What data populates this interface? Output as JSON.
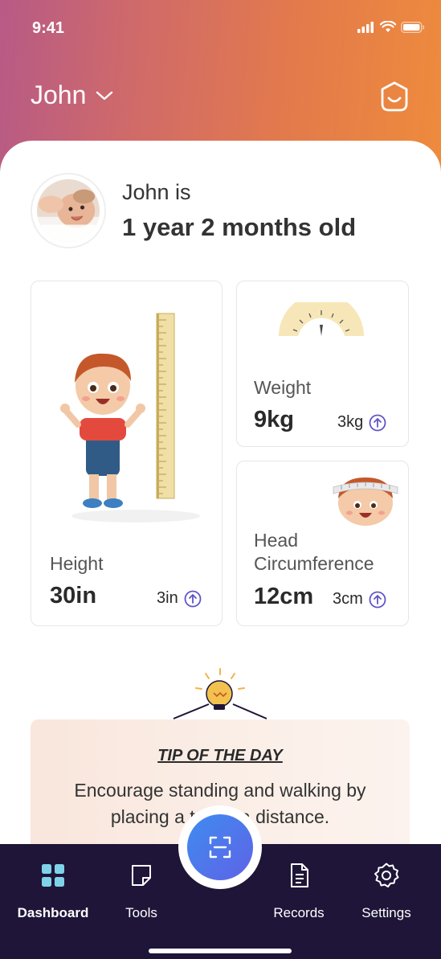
{
  "status_bar": {
    "time": "9:41"
  },
  "header": {
    "child_name": "John",
    "chevron_icon": "chevron-down-icon",
    "profile_icon": "smile-icon"
  },
  "profile": {
    "age_prefix": "John is",
    "age_value": "1 year 2 months old"
  },
  "metrics": {
    "height": {
      "label": "Height",
      "value": "30in",
      "change": "3in"
    },
    "weight": {
      "label": "Weight",
      "value": "9kg",
      "change": "3kg"
    },
    "head": {
      "label_line1": "Head",
      "label_line2": "Circumference",
      "value": "12cm",
      "change": "3cm"
    }
  },
  "tip": {
    "title": "TIP OF THE DAY",
    "text": "Encourage standing and walking by placing a toy at a distance."
  },
  "tabs": [
    {
      "label": "Dashboard",
      "icon": "grid-icon",
      "active": true
    },
    {
      "label": "Tools",
      "icon": "note-icon",
      "active": false
    },
    {
      "label": "Records",
      "icon": "document-icon",
      "active": false
    },
    {
      "label": "Settings",
      "icon": "gear-icon",
      "active": false
    }
  ],
  "colors": {
    "tab_bar": "#1e1538",
    "accent": "#5f62e6",
    "active_tab_icon": "#7fd3e8",
    "tip_bg": "#f9e6dc"
  }
}
